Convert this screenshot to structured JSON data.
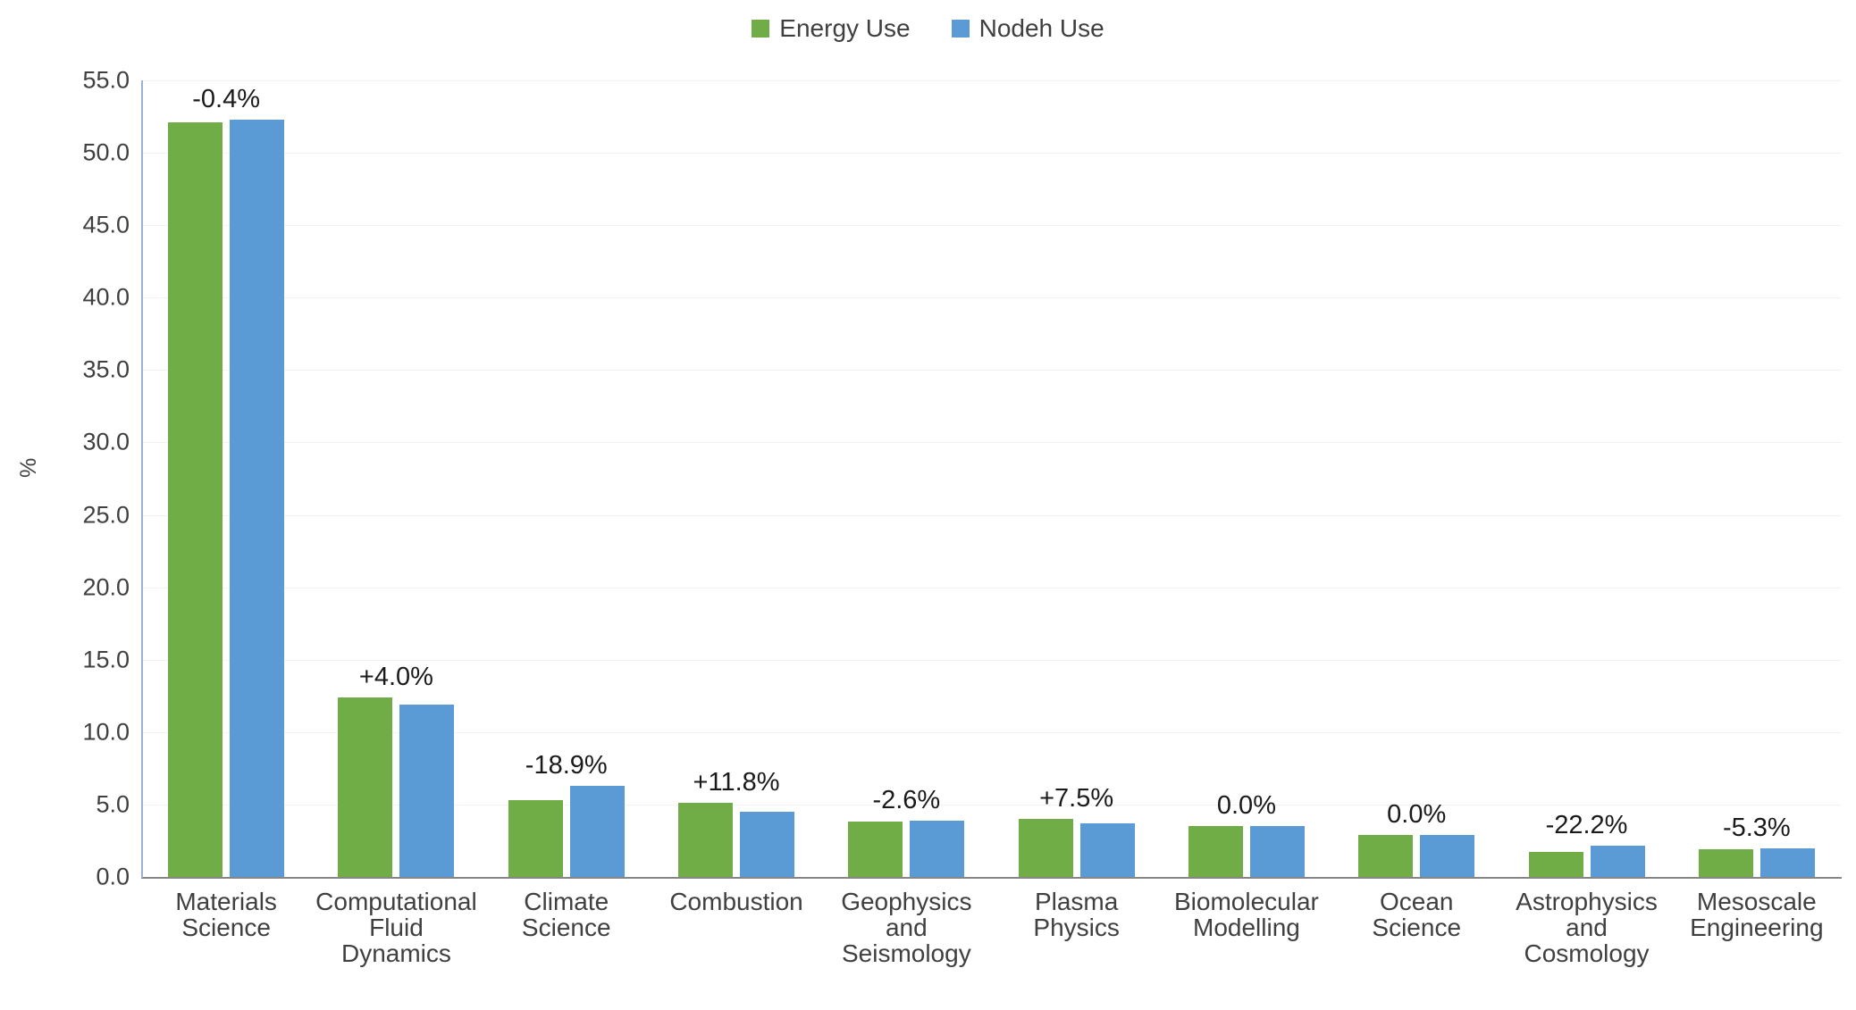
{
  "chart_data": {
    "type": "bar",
    "title": "",
    "subtitle": "",
    "xlabel": "",
    "ylabel": "%",
    "ylim": [
      0.0,
      55.0
    ],
    "ytick_step": 5.0,
    "ytick_labels": [
      "55.0",
      "50.0",
      "45.0",
      "40.0",
      "35.0",
      "30.0",
      "25.0",
      "20.0",
      "15.0",
      "10.0",
      "5.0",
      "0.0"
    ],
    "grid": "horizontal",
    "legend_position": "top-center",
    "categories": [
      "Materials Science",
      "Computational Fluid Dynamics",
      "Climate Science",
      "Combustion",
      "Geophysics and Seismology",
      "Plasma Physics",
      "Biomolecular Modelling",
      "Ocean Science",
      "Astrophysics and Cosmology",
      "Mesoscale Engineering"
    ],
    "category_lines": [
      [
        "Materials",
        "Science"
      ],
      [
        "Computational",
        "Fluid Dynamics"
      ],
      [
        "Climate",
        "Science"
      ],
      [
        "Combustion"
      ],
      [
        "Geophysics",
        "and",
        "Seismology"
      ],
      [
        "Plasma Physics"
      ],
      [
        "Biomolecular",
        "Modelling"
      ],
      [
        "Ocean Science"
      ],
      [
        "Astrophysics",
        "and Cosmology"
      ],
      [
        "Mesoscale",
        "Engineering"
      ]
    ],
    "series": [
      {
        "name": "Energy Use",
        "color": "#70AD47",
        "values": [
          52.1,
          12.4,
          5.3,
          5.1,
          3.8,
          4.0,
          3.5,
          2.9,
          1.75,
          1.9
        ]
      },
      {
        "name": "Nodeh Use",
        "color": "#5B9BD5",
        "values": [
          52.3,
          11.9,
          6.3,
          4.5,
          3.9,
          3.7,
          3.5,
          2.9,
          2.15,
          2.0
        ]
      }
    ],
    "annotations": [
      "-0.4%",
      "+4.0%",
      "-18.9%",
      "+11.8%",
      "-2.6%",
      "+7.5%",
      "0.0%",
      "0.0%",
      "-22.2%",
      "-5.3%"
    ]
  },
  "legend": {
    "items": [
      {
        "label": "Energy Use",
        "color": "#70AD47"
      },
      {
        "label": "Nodeh Use",
        "color": "#5B9BD5"
      }
    ]
  }
}
